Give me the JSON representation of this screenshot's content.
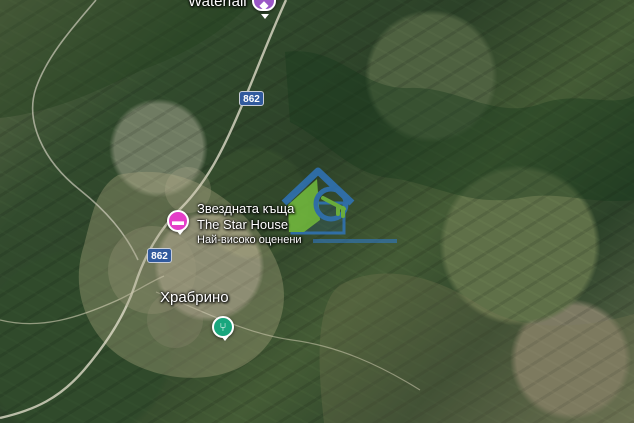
{
  "map": {
    "top_label": "Waterfall",
    "star_house": {
      "line1": "Звездната къща",
      "line2": "The Star House",
      "line3": "Най-високо оценени"
    },
    "road_number_top": "862",
    "road_number_left": "862",
    "village_label": "Храбрино",
    "icons": {
      "waterfall": "landmark-icon",
      "hotel": "hotel-icon",
      "restaurant": "restaurant-icon",
      "watermark": "agency-watermark-icon"
    },
    "colors": {
      "pink": "#e43ec8",
      "green": "#19a67d",
      "road_shield": "#315a9d",
      "watermark": "#2f78c7"
    }
  }
}
